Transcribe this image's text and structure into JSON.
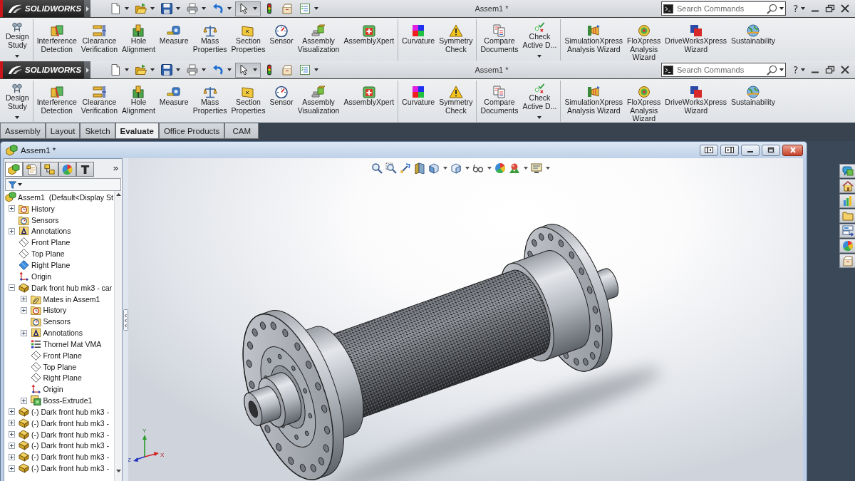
{
  "command_bars": [
    {
      "logo": "SOLIDWORKS",
      "quick_access": [
        {
          "dropdown": true,
          "pressed": false
        },
        {
          "dropdown": true,
          "pressed": false
        },
        {
          "dropdown": true,
          "pressed": false
        },
        {
          "dropdown": true,
          "pressed": false
        },
        {
          "dropdown": true,
          "pressed": false
        },
        {
          "dropdown": true,
          "pressed": true
        },
        {
          "dropdown": false,
          "pressed": false
        },
        {
          "dropdown": false,
          "pressed": false
        },
        {
          "dropdown": true,
          "pressed": false
        }
      ],
      "title": "Assem1 *",
      "search": {
        "placeholder": "Search Commands"
      },
      "help": "?",
      "ribbon": {
        "groups": [
          {
            "items": [
              {
                "label": "Design\nStudy",
                "dropdown": true
              }
            ]
          },
          {
            "items": [
              {
                "label": "Interference\nDetection",
                "dropdown": false
              },
              {
                "label": "Clearance\nVerification",
                "dropdown": false
              },
              {
                "label": "Hole\nAlignment",
                "dropdown": false
              },
              {
                "label": "Measure",
                "dropdown": false
              },
              {
                "label": "Mass\nProperties",
                "dropdown": false
              },
              {
                "label": "Section\nProperties",
                "dropdown": false
              },
              {
                "label": "Sensor",
                "dropdown": false
              },
              {
                "label": "Assembly\nVisualization",
                "dropdown": false
              },
              {
                "label": "AssemblyXpert",
                "dropdown": false
              }
            ]
          },
          {
            "items": [
              {
                "label": "Curvature",
                "dropdown": false
              },
              {
                "label": "Symmetry\nCheck",
                "dropdown": false
              }
            ]
          },
          {
            "items": [
              {
                "label": "Compare\nDocuments",
                "dropdown": false
              },
              {
                "label": "Check\nActive D...",
                "dropdown": true
              }
            ]
          },
          {
            "items": [
              {
                "label": "SimulationXpress\nAnalysis Wizard",
                "dropdown": false
              },
              {
                "label": "FloXpress\nAnalysis\nWizard",
                "dropdown": false
              },
              {
                "label": "DriveWorksXpress\nWizard",
                "dropdown": false
              },
              {
                "label": "Sustainability",
                "dropdown": false
              }
            ]
          }
        ]
      }
    },
    {
      "logo": "SOLIDWORKS",
      "quick_access": [
        {
          "dropdown": true,
          "pressed": false
        },
        {
          "dropdown": true,
          "pressed": false
        },
        {
          "dropdown": true,
          "pressed": false
        },
        {
          "dropdown": true,
          "pressed": false
        },
        {
          "dropdown": true,
          "pressed": false
        },
        {
          "dropdown": true,
          "pressed": true
        },
        {
          "dropdown": false,
          "pressed": false
        },
        {
          "dropdown": false,
          "pressed": false
        },
        {
          "dropdown": true,
          "pressed": false
        }
      ],
      "title": "Assem1 *",
      "search": {
        "placeholder": "Search Commands"
      },
      "help": "?",
      "ribbon": {
        "groups": [
          {
            "items": [
              {
                "label": "Design\nStudy",
                "dropdown": true
              }
            ]
          },
          {
            "items": [
              {
                "label": "Interference\nDetection",
                "dropdown": false
              },
              {
                "label": "Clearance\nVerification",
                "dropdown": false
              },
              {
                "label": "Hole\nAlignment",
                "dropdown": false
              },
              {
                "label": "Measure",
                "dropdown": false
              },
              {
                "label": "Mass\nProperties",
                "dropdown": false
              },
              {
                "label": "Section\nProperties",
                "dropdown": false
              },
              {
                "label": "Sensor",
                "dropdown": false
              },
              {
                "label": "Assembly\nVisualization",
                "dropdown": false
              },
              {
                "label": "AssemblyXpert",
                "dropdown": false
              }
            ]
          },
          {
            "items": [
              {
                "label": "Curvature",
                "dropdown": false
              },
              {
                "label": "Symmetry\nCheck",
                "dropdown": false
              }
            ]
          },
          {
            "items": [
              {
                "label": "Compare\nDocuments",
                "dropdown": false
              },
              {
                "label": "Check\nActive D...",
                "dropdown": true
              }
            ]
          },
          {
            "items": [
              {
                "label": "SimulationXpress\nAnalysis Wizard",
                "dropdown": false
              },
              {
                "label": "FloXpress\nAnalysis\nWizard",
                "dropdown": false
              },
              {
                "label": "DriveWorksXpress\nWizard",
                "dropdown": false
              },
              {
                "label": "Sustainability",
                "dropdown": false
              }
            ]
          }
        ]
      }
    }
  ],
  "tabs": [
    {
      "label": "Assembly",
      "selected": false
    },
    {
      "label": "Layout",
      "selected": false
    },
    {
      "label": "Sketch",
      "selected": false
    },
    {
      "label": "Evaluate",
      "selected": true
    },
    {
      "label": "Office Products",
      "selected": false
    },
    {
      "label": "CAM",
      "selected": false
    }
  ],
  "document": {
    "title": "Assem1 *",
    "panel_tabs": [
      {
        "selected": true
      },
      {
        "selected": false
      },
      {
        "selected": false
      },
      {
        "selected": false
      },
      {
        "selected": false
      }
    ],
    "panel_more": "»",
    "view_toolbar": [
      {
        "dropdown": false
      },
      {
        "dropdown": false
      },
      {
        "dropdown": false
      },
      {
        "dropdown": false
      },
      {
        "dropdown": true
      },
      {
        "dropdown": true
      },
      {
        "dropdown": true
      },
      {
        "dropdown": false
      },
      {
        "dropdown": true
      },
      {
        "dropdown": true
      }
    ]
  },
  "feature_tree": {
    "root": {
      "label": "Assem1  (Default<Display St",
      "kind": "assembly",
      "children": [
        {
          "label": "History",
          "kind": "history",
          "expanded": false
        },
        {
          "label": "Sensors",
          "kind": "sensors"
        },
        {
          "label": "Annotations",
          "kind": "annotations",
          "expanded": false
        },
        {
          "label": "Front Plane",
          "kind": "plane",
          "shown": false
        },
        {
          "label": "Top Plane",
          "kind": "plane",
          "shown": false
        },
        {
          "label": "Right Plane",
          "kind": "plane",
          "shown": true
        },
        {
          "label": "Origin",
          "kind": "origin"
        },
        {
          "label": "Dark front hub mk3 - car",
          "kind": "part",
          "expanded": true,
          "children": [
            {
              "label": "Mates in Assem1",
              "kind": "mates",
              "expanded": false
            },
            {
              "label": "History",
              "kind": "history",
              "expanded": false
            },
            {
              "label": "Sensors",
              "kind": "sensors"
            },
            {
              "label": "Annotations",
              "kind": "annotations",
              "expanded": false
            },
            {
              "label": "Thornel Mat VMA",
              "kind": "material"
            },
            {
              "label": "Front Plane",
              "kind": "plane",
              "shown": false
            },
            {
              "label": "Top Plane",
              "kind": "plane",
              "shown": false
            },
            {
              "label": "Right Plane",
              "kind": "plane",
              "shown": false
            },
            {
              "label": "Origin",
              "kind": "origin"
            },
            {
              "label": "Boss-Extrude1",
              "kind": "feature",
              "expanded": false
            }
          ]
        },
        {
          "label": "(-) Dark front hub mk3 -",
          "kind": "part",
          "expanded": false
        },
        {
          "label": "(-) Dark front hub mk3 -",
          "kind": "part",
          "expanded": false
        },
        {
          "label": "(-) Dark front hub mk3 -",
          "kind": "part",
          "expanded": false
        },
        {
          "label": "(-) Dark front hub mk3 -",
          "kind": "part",
          "expanded": false
        },
        {
          "label": "(-) Dark front hub mk3 -",
          "kind": "part",
          "expanded": false
        },
        {
          "label": "(-) Dark front hub mk3 -",
          "kind": "part",
          "expanded": false
        }
      ]
    }
  },
  "triad": {
    "x": "X",
    "y": "Y",
    "z": "Z"
  }
}
